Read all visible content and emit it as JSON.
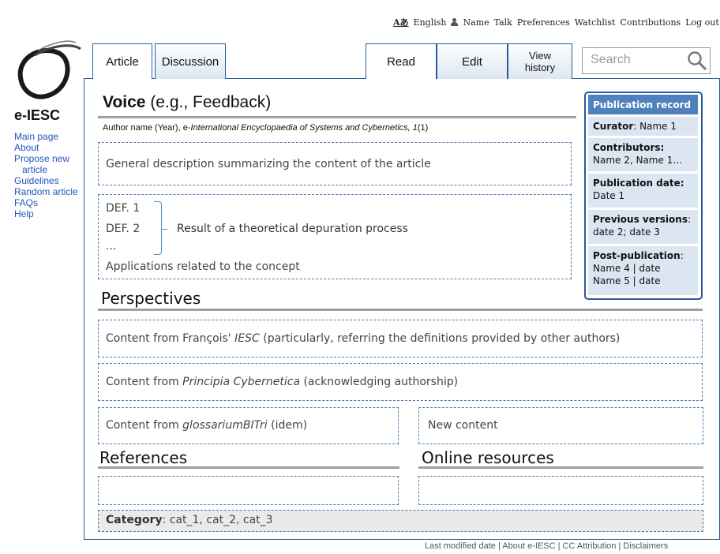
{
  "personal_bar": {
    "language": "English",
    "username": "Name",
    "talk": "Talk",
    "preferences": "Preferences",
    "watchlist": "Watchlist",
    "contributions": "Contributions",
    "logout": "Log out"
  },
  "site": {
    "name": "e-IESC"
  },
  "sidebar": {
    "items": [
      {
        "label": "Main page"
      },
      {
        "label": "About"
      },
      {
        "label": "Propose new"
      },
      {
        "label": "article"
      },
      {
        "label": "Guidelines"
      },
      {
        "label": "Random article"
      },
      {
        "label": "FAQs"
      },
      {
        "label": "Help"
      }
    ]
  },
  "tabs": {
    "article": "Article",
    "discussion": "Discussion",
    "read": "Read",
    "edit": "Edit",
    "view_history_1": "View",
    "view_history_2": "history"
  },
  "search": {
    "placeholder": "Search"
  },
  "article": {
    "title_bold": "Voice",
    "title_rest": "(e.g., Feedback)",
    "citation_prefix": "Author name (Year), e-",
    "citation_journal": "International Encyclopaedia of Systems and Cybernetics, 1",
    "citation_issue": "(1)",
    "description": "General description summarizing the content of the article",
    "def1": "DEF. 1",
    "def2": "DEF. 2",
    "ellipsis": "...",
    "def_result": "Result of a theoretical depuration process",
    "applications": "Applications related to the concept"
  },
  "perspectives": {
    "heading": "Perspectives",
    "francois_pre": "Content from François'",
    "francois_italic": "IESC",
    "francois_post": "(particularly, referring the definitions provided by other authors)",
    "principia_pre": "Content from",
    "principia_italic": "Principia Cybernetica",
    "principia_post": "(acknowledging authorship)",
    "glossarium_pre": "Content from",
    "glossarium_italic": "glossariumBITri",
    "glossarium_post": "(idem)",
    "new_content": "New content"
  },
  "references": {
    "heading": "References"
  },
  "online_resources": {
    "heading": "Online resources"
  },
  "category": {
    "label": "Category",
    "values": ": cat_1, cat_2, cat_3"
  },
  "publication_record": {
    "header": "Publication record",
    "curator_label": "Curator",
    "curator_value": ": Name 1",
    "contributors_label": "Contributors",
    "contributors_value": "Name 2, Name 1…",
    "pubdate_label": "Publication date",
    "pubdate_value": "Date 1",
    "prev_label": "Previous versions",
    "prev_value": "date 2; date 3",
    "post_label": "Post-publication",
    "post_value_1": "Name 4 | date",
    "post_value_2": "Name 5 | date"
  },
  "footer": {
    "last_modified": "Last modified date",
    "about": "About e-IESC",
    "license": "CC Attribution",
    "disclaimers": "Disclaimers"
  }
}
